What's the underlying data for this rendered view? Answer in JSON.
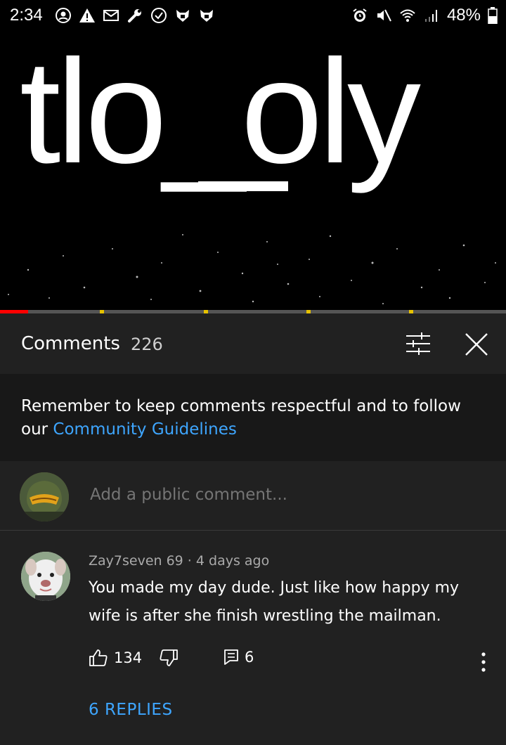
{
  "status_bar": {
    "time": "2:34",
    "battery": "48%",
    "icons_left": [
      "account-icon",
      "warning-icon",
      "mail-icon",
      "wrench-icon",
      "check-circle-icon",
      "game-icon",
      "game-icon"
    ],
    "icons_right": [
      "alarm-icon",
      "mute-icon",
      "wifi-icon",
      "signal-icon",
      "battery-icon"
    ]
  },
  "video": {
    "title_text": "tlo_oly",
    "progress_fraction": 0.055
  },
  "comments": {
    "title": "Comments",
    "count": "226",
    "notice_text": "Remember to keep comments respectful and to follow our ",
    "notice_link": "Community Guidelines",
    "add_placeholder": "Add a public comment...",
    "list": [
      {
        "author": "Zay7seven 69",
        "age": "4 days ago",
        "meta": "Zay7seven 69 · 4 days ago",
        "text": "You made my day dude. Just like how happy my wife is after she finish wrestling the mailman.",
        "likes": "134",
        "reply_count": "6",
        "replies_label": "6 REPLIES"
      }
    ]
  },
  "colors": {
    "background": "#212121",
    "notice_bg": "#181818",
    "link": "#3ea6ff",
    "progress": "#ff0000"
  }
}
